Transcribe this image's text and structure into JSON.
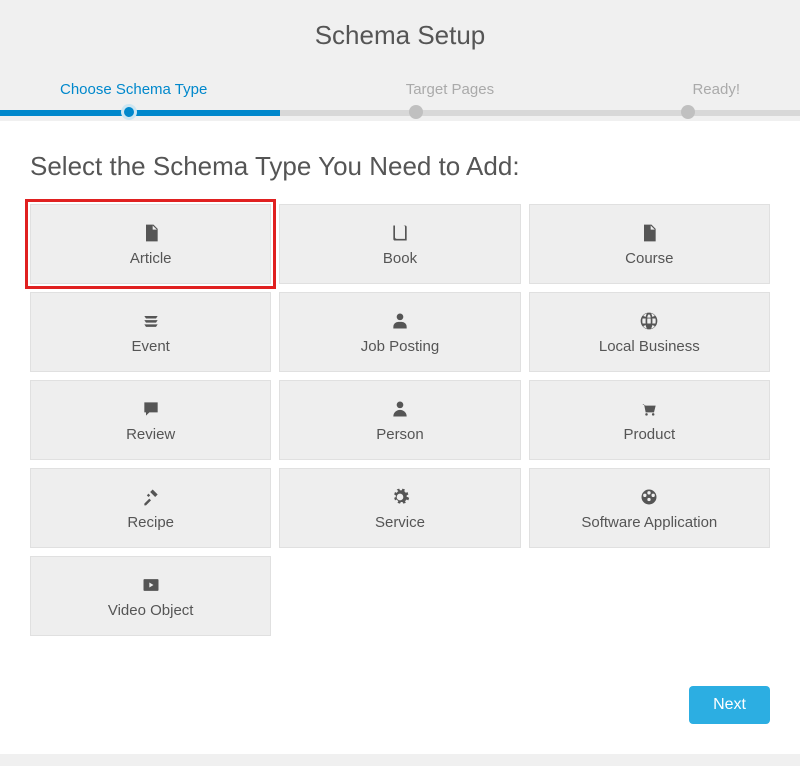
{
  "title": "Schema Setup",
  "steps": {
    "s1": "Choose Schema Type",
    "s2": "Target Pages",
    "s3": "Ready!"
  },
  "section_title": "Select the Schema Type You Need to Add:",
  "tiles": {
    "article": "Article",
    "book": "Book",
    "course": "Course",
    "event": "Event",
    "job": "Job Posting",
    "local": "Local Business",
    "review": "Review",
    "person": "Person",
    "product": "Product",
    "recipe": "Recipe",
    "service": "Service",
    "software": "Software Application",
    "video": "Video Object"
  },
  "actions": {
    "next": "Next"
  }
}
